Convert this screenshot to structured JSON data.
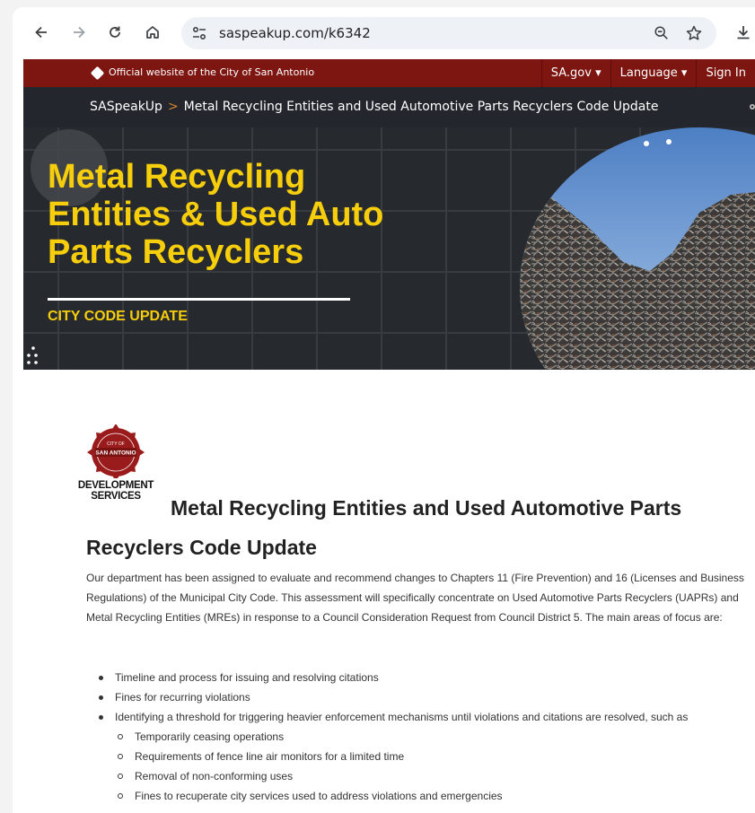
{
  "browser": {
    "url": "saspeakup.com/k6342"
  },
  "official_bar": {
    "text": "Official website of the City of San Antonio",
    "links": [
      "SA.gov ▾",
      "Language ▾",
      "Sign In"
    ]
  },
  "breadcrumb": {
    "home": "SASpeakUp",
    "separator": ">",
    "current": "Metal Recycling Entities and Used Automotive Parts Recyclers Code Update"
  },
  "banner": {
    "title_lines": [
      "Metal Recycling",
      "Entities & Used Auto",
      "Parts Recyclers"
    ],
    "subtitle": "CITY CODE UPDATE"
  },
  "logo": {
    "seal_top": "CITY OF",
    "seal_main": "SAN ANTONIO",
    "line1": "DEVELOPMENT",
    "line2": "SERVICES"
  },
  "page": {
    "title": "Metal Recycling Entities and Used Automotive Parts Recyclers Code Update",
    "intro": "Our department has been assigned to evaluate and recommend changes to Chapters 11 (Fire Prevention) and 16 (Licenses and Business Regulations) of the Municipal City Code. This assessment will specifically concentrate on Used Automotive Parts Recyclers (UAPRs) and Metal Recycling Entities (MREs) in response to a Council Consideration Request from Council District 5. The main areas of focus are:",
    "focus_items": [
      "Timeline and process for issuing and resolving citations",
      "Fines for recurring violations",
      "Identifying a threshold for triggering heavier enforcement mechanisms until violations and citations are resolved, such as"
    ],
    "sub_items": [
      "Temporarily ceasing operations",
      "Requirements of fence line air monitors for a limited time",
      "Removal of non-conforming uses",
      "Fines to recuperate city services used to address violations and emergencies"
    ]
  }
}
